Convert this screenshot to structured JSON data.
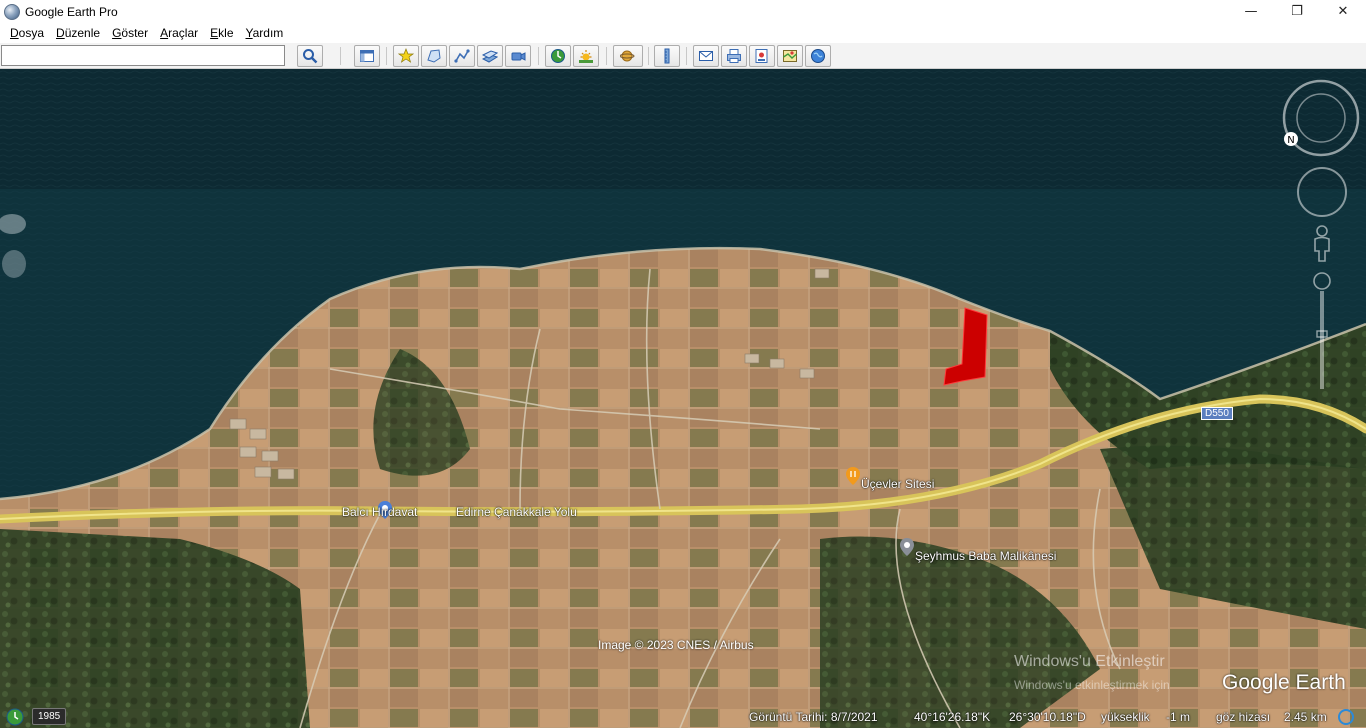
{
  "window": {
    "title": "Google Earth Pro",
    "minimize": "—",
    "maximize": "❐",
    "close": "✕"
  },
  "menu": {
    "items": [
      {
        "first": "D",
        "rest": "osya"
      },
      {
        "first": "D",
        "rest": "üzenle"
      },
      {
        "first": "G",
        "rest": "öster"
      },
      {
        "first": "A",
        "rest": "raçlar"
      },
      {
        "first": "E",
        "rest": "kle"
      },
      {
        "first": "Y",
        "rest": "ardım"
      }
    ]
  },
  "toolbar": {
    "search_value": "",
    "buttons": [
      "search-icon",
      "sidebar-toggle-icon",
      "add-placemark-icon",
      "add-polygon-icon",
      "add-path-icon",
      "add-image-overlay-icon",
      "record-tour-icon",
      "historical-imagery-icon",
      "sunlight-icon",
      "planet-switch-icon",
      "ruler-icon",
      "email-icon",
      "print-icon",
      "save-image-icon",
      "view-in-maps-icon",
      "earth-gallery-icon"
    ]
  },
  "map": {
    "labels": {
      "balci": "Balcı Hırdavat",
      "road": "Edirne Çanakkale Yolu",
      "ucevler": "Üçevler Sitesi",
      "seyhmus": "Şeyhmus Baba Malikânesi",
      "d550": "D550"
    },
    "copyright": "Image © 2023 CNES / Airbus",
    "watermark": "Windows'u Etkinleştir",
    "watermark_sub": "Windows'u etkinleştirmek için",
    "logo": "Google Earth",
    "compass_north": "N"
  },
  "status": {
    "year": "1985",
    "image_date": "Görüntü Tarihi: 8/7/2021",
    "latitude": "40°16'26.18\"K",
    "longitude": "26°30'10.18\"D",
    "elevation_label": "yükseklik",
    "elevation_value": "-1 m",
    "eye_alt_label": "göz hizası",
    "eye_alt_value": "2.45 km"
  },
  "colors": {
    "sea": "#0d2a33",
    "land": "#b8906a",
    "vegetation": "#2e4424",
    "road": "#d8c45a",
    "parcel": "#cc0000",
    "accent": "#2b8ad8"
  }
}
